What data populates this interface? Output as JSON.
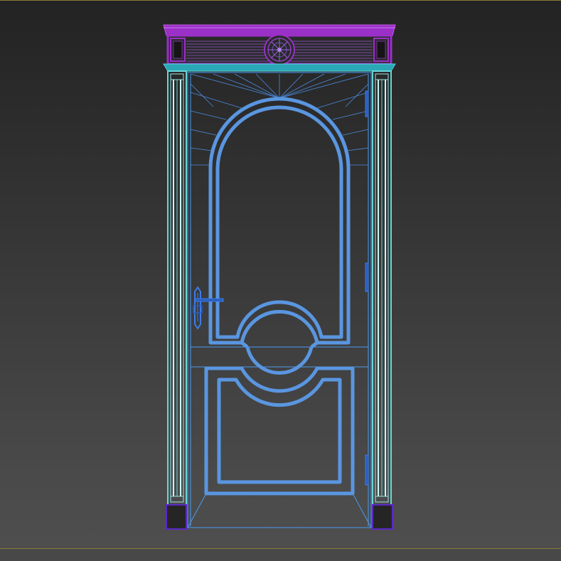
{
  "viewport": {
    "background_top": "#232323",
    "background_bottom": "#4f4f4f",
    "frame_color": "#8a7a3a"
  },
  "model": {
    "object": "door",
    "colors": {
      "cornice": "#9b30c8",
      "cornice_dark": "#7a2aa8",
      "header_trim": "#2aa8b8",
      "pilaster": "#6ad6d6",
      "pilaster_light": "#b8f0f0",
      "door_panel": "#5a96e0",
      "door_thin": "#3c8ce0",
      "hardware": "#2a5cc0",
      "plinth": "#5a28c8"
    }
  }
}
